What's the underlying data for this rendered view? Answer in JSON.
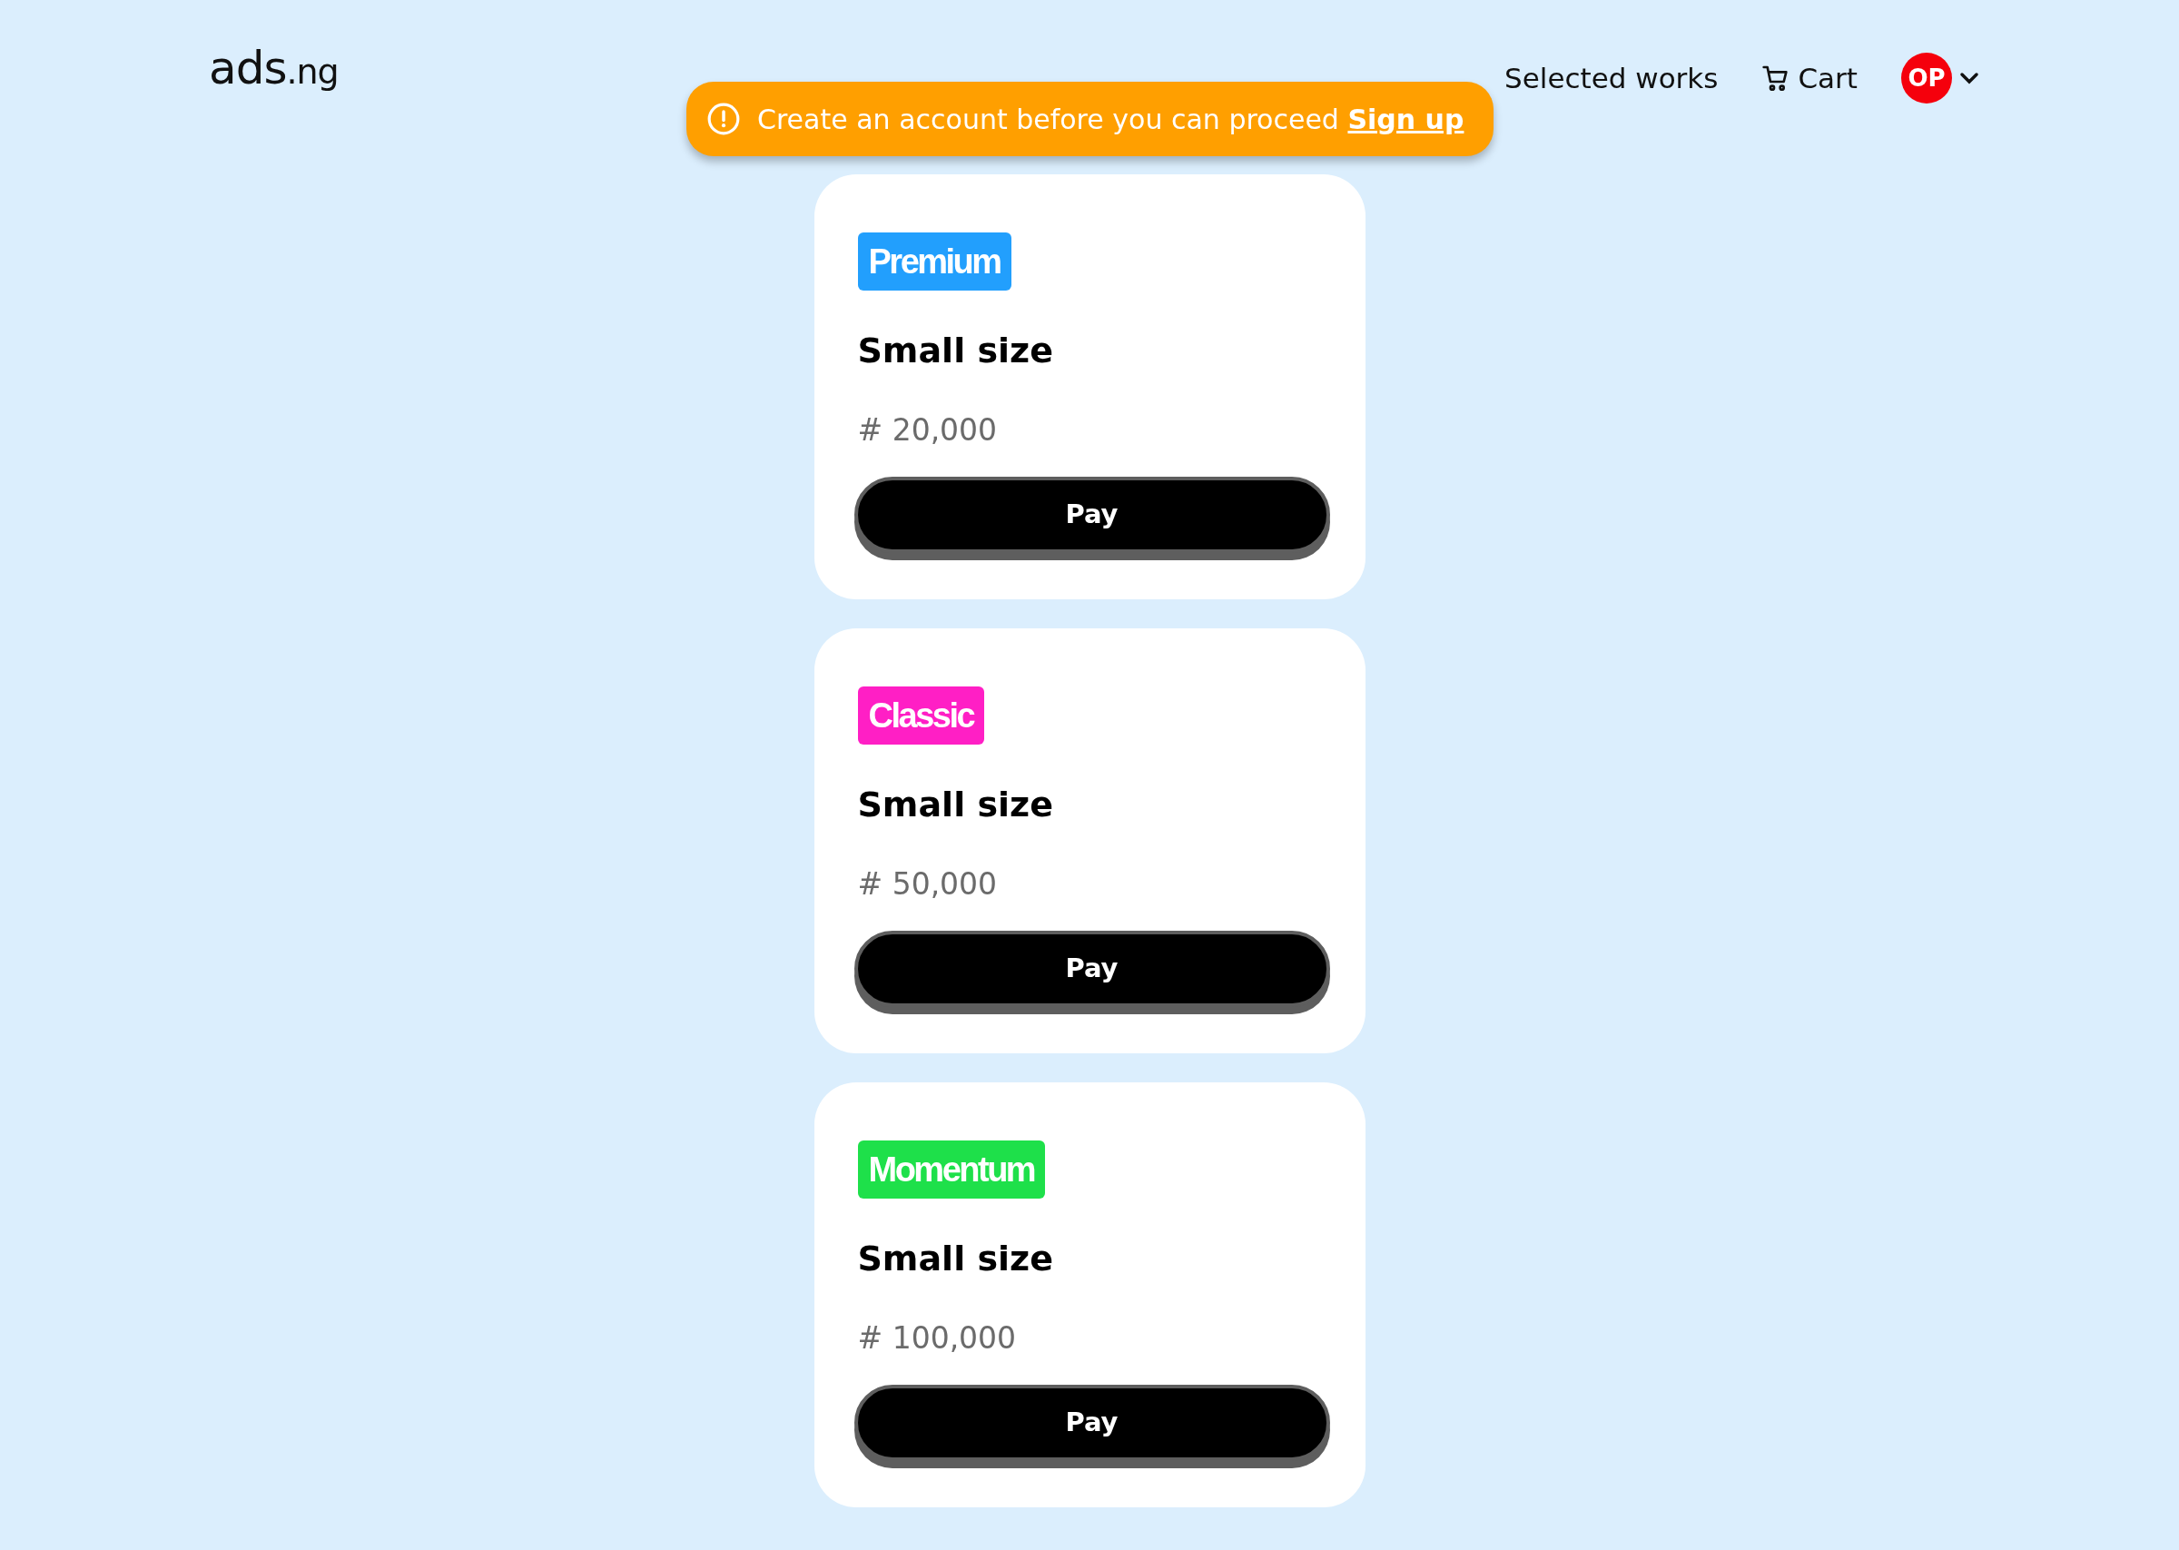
{
  "header": {
    "logo": {
      "main": "ads",
      "suffix": ".ng"
    },
    "nav": [
      {
        "kind": "link",
        "label": "Selected works"
      },
      {
        "kind": "cart",
        "label": "Cart"
      }
    ],
    "avatar": {
      "initials": "OP"
    }
  },
  "alert": {
    "message": "Create an account before you can proceed",
    "link": "Sign up"
  },
  "plans": [
    {
      "tag": "Premium",
      "color": "#229ffd",
      "title": "Small size",
      "price": "# 20,000",
      "button": "Pay"
    },
    {
      "tag": "Classic",
      "color": "#ff1fc5",
      "title": "Small size",
      "price": "# 50,000",
      "button": "Pay"
    },
    {
      "tag": "Momentum",
      "color": "#1ee04a",
      "title": "Small size",
      "price": "# 100,000",
      "button": "Pay"
    }
  ]
}
